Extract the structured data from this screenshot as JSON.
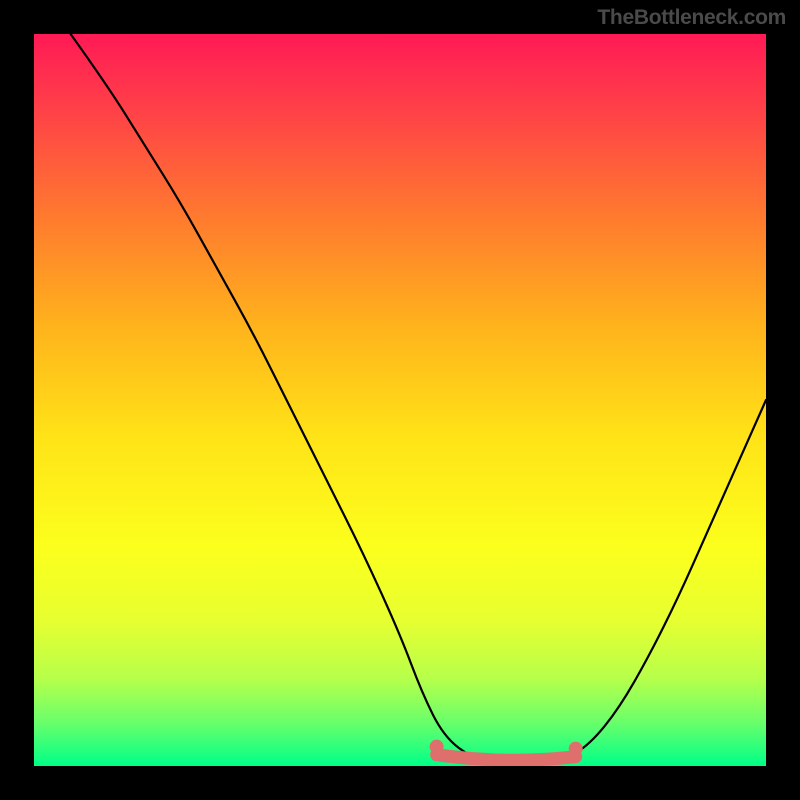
{
  "watermark": "TheBottleneck.com",
  "chart_data": {
    "type": "line",
    "title": "",
    "xlabel": "",
    "ylabel": "",
    "xlim": [
      0,
      100
    ],
    "ylim": [
      0,
      100
    ],
    "series": [
      {
        "name": "curve",
        "x": [
          5,
          10,
          15,
          20,
          25,
          30,
          35,
          40,
          45,
          50,
          53,
          56,
          60,
          64,
          68,
          72,
          76,
          80,
          84,
          88,
          92,
          96,
          100
        ],
        "values": [
          100,
          93,
          85,
          77,
          68,
          59,
          49,
          39,
          29,
          18,
          10,
          4,
          1,
          0,
          0,
          0.5,
          3,
          8,
          15,
          23,
          32,
          41,
          50
        ]
      }
    ],
    "highlight_band": {
      "x_start": 55,
      "x_end": 74,
      "y": 1.0
    },
    "gradient_stops": [
      {
        "pos": 0,
        "color": "#ff1a55"
      },
      {
        "pos": 25,
        "color": "#ff7a2e"
      },
      {
        "pos": 55,
        "color": "#ffe317"
      },
      {
        "pos": 80,
        "color": "#e7ff30"
      },
      {
        "pos": 100,
        "color": "#00ff88"
      }
    ]
  }
}
